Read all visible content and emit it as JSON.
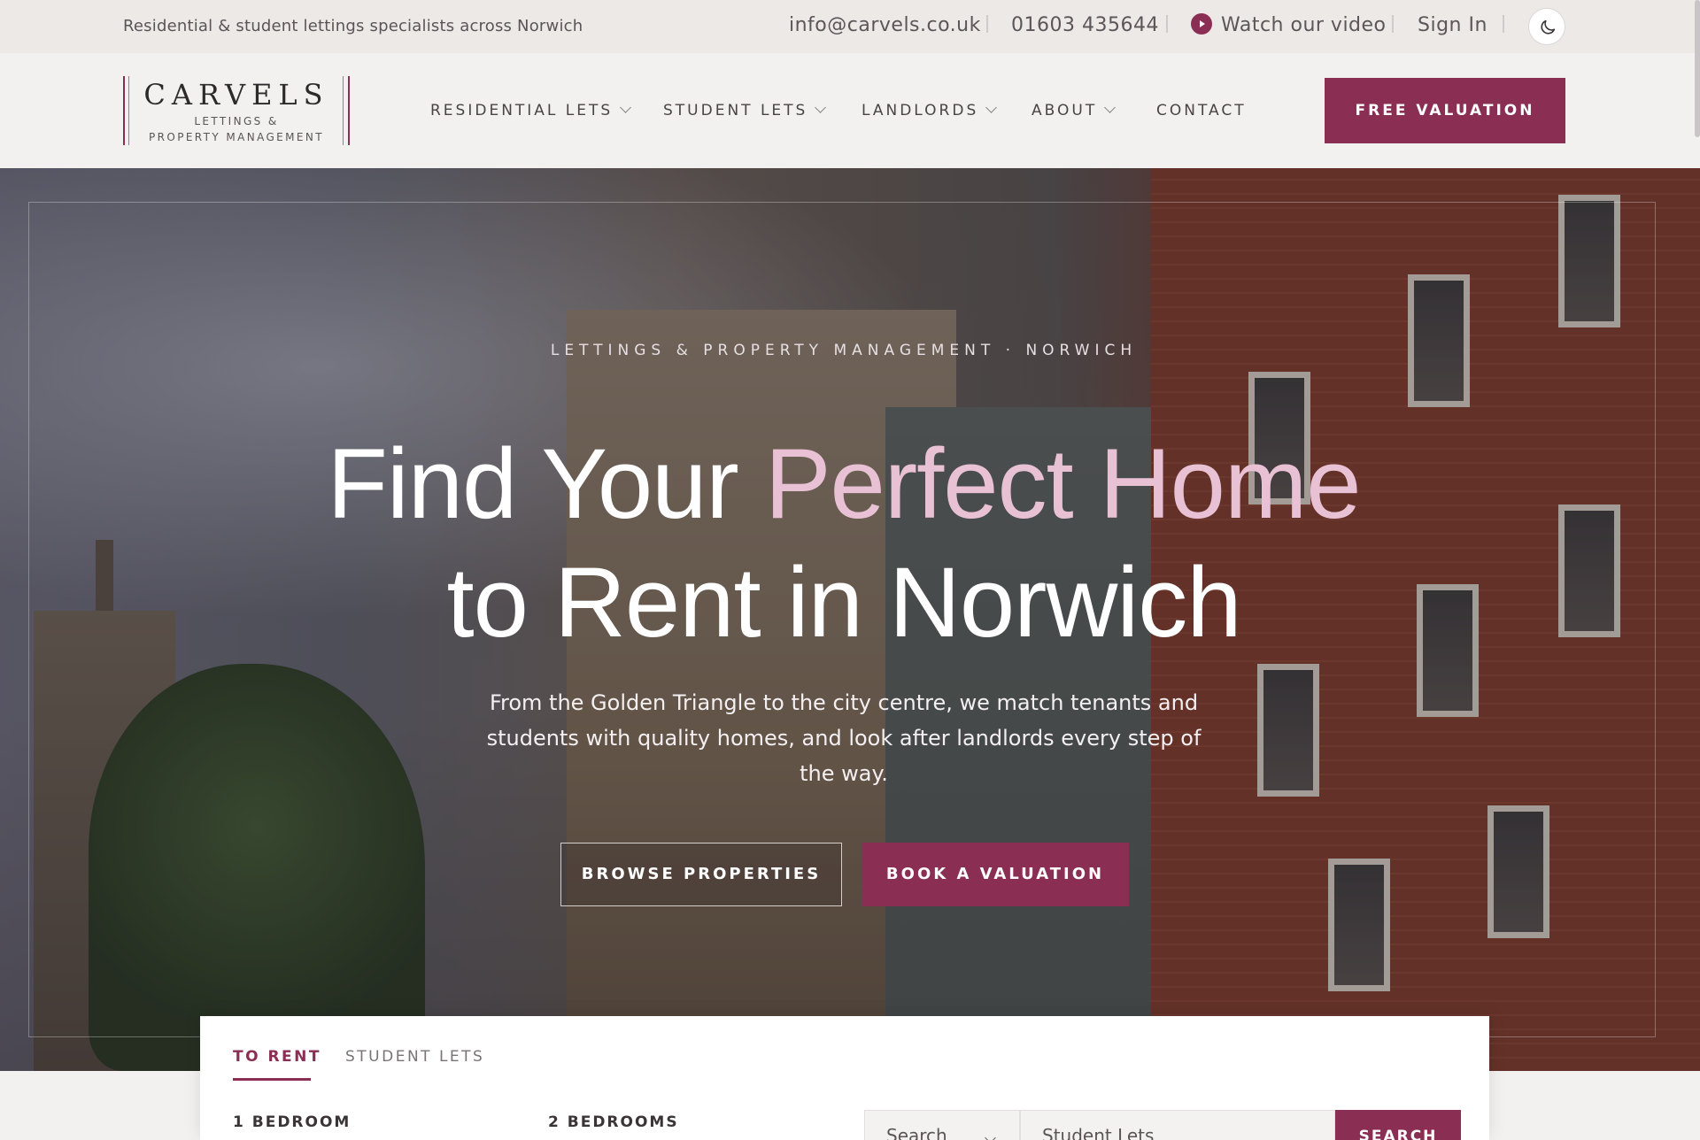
{
  "topbar": {
    "tagline": "Residential & student lettings specialists across Norwich",
    "email": "info@carvels.co.uk",
    "phone": "01603 435644",
    "video_label": "Watch our video",
    "sign_in": "Sign In",
    "theme_icon": "moon-icon"
  },
  "brand": {
    "name": "CARVELS",
    "sub_line1": "LETTINGS &",
    "sub_line2": "PROPERTY MANAGEMENT",
    "accent_color": "#8b2e54"
  },
  "nav": {
    "items": [
      {
        "label": "RESIDENTIAL LETS",
        "has_dropdown": true
      },
      {
        "label": "STUDENT LETS",
        "has_dropdown": true
      },
      {
        "label": "LANDLORDS",
        "has_dropdown": true
      },
      {
        "label": "ABOUT",
        "has_dropdown": true
      },
      {
        "label": "CONTACT",
        "has_dropdown": false
      }
    ],
    "cta": "FREE VALUATION"
  },
  "hero": {
    "eyebrow": "LETTINGS & PROPERTY MANAGEMENT · NORWICH",
    "headline_part1": "Find Your ",
    "headline_accent": "Perfect Home",
    "headline_line2": "to Rent in Norwich",
    "lead": "From the Golden Triangle to the city centre, we match tenants and students with quality homes, and look after landlords every step of the way.",
    "primary_button": "BROWSE PROPERTIES",
    "secondary_button": "BOOK A VALUATION"
  },
  "search": {
    "tabs": [
      {
        "label": "TO RENT",
        "active": true
      },
      {
        "label": "STUDENT LETS",
        "active": false
      }
    ],
    "filters": [
      "1 BEDROOM",
      "2 BEDROOMS"
    ],
    "select_value": "Search",
    "location_value": "Student Lets",
    "submit": "SEARCH"
  }
}
